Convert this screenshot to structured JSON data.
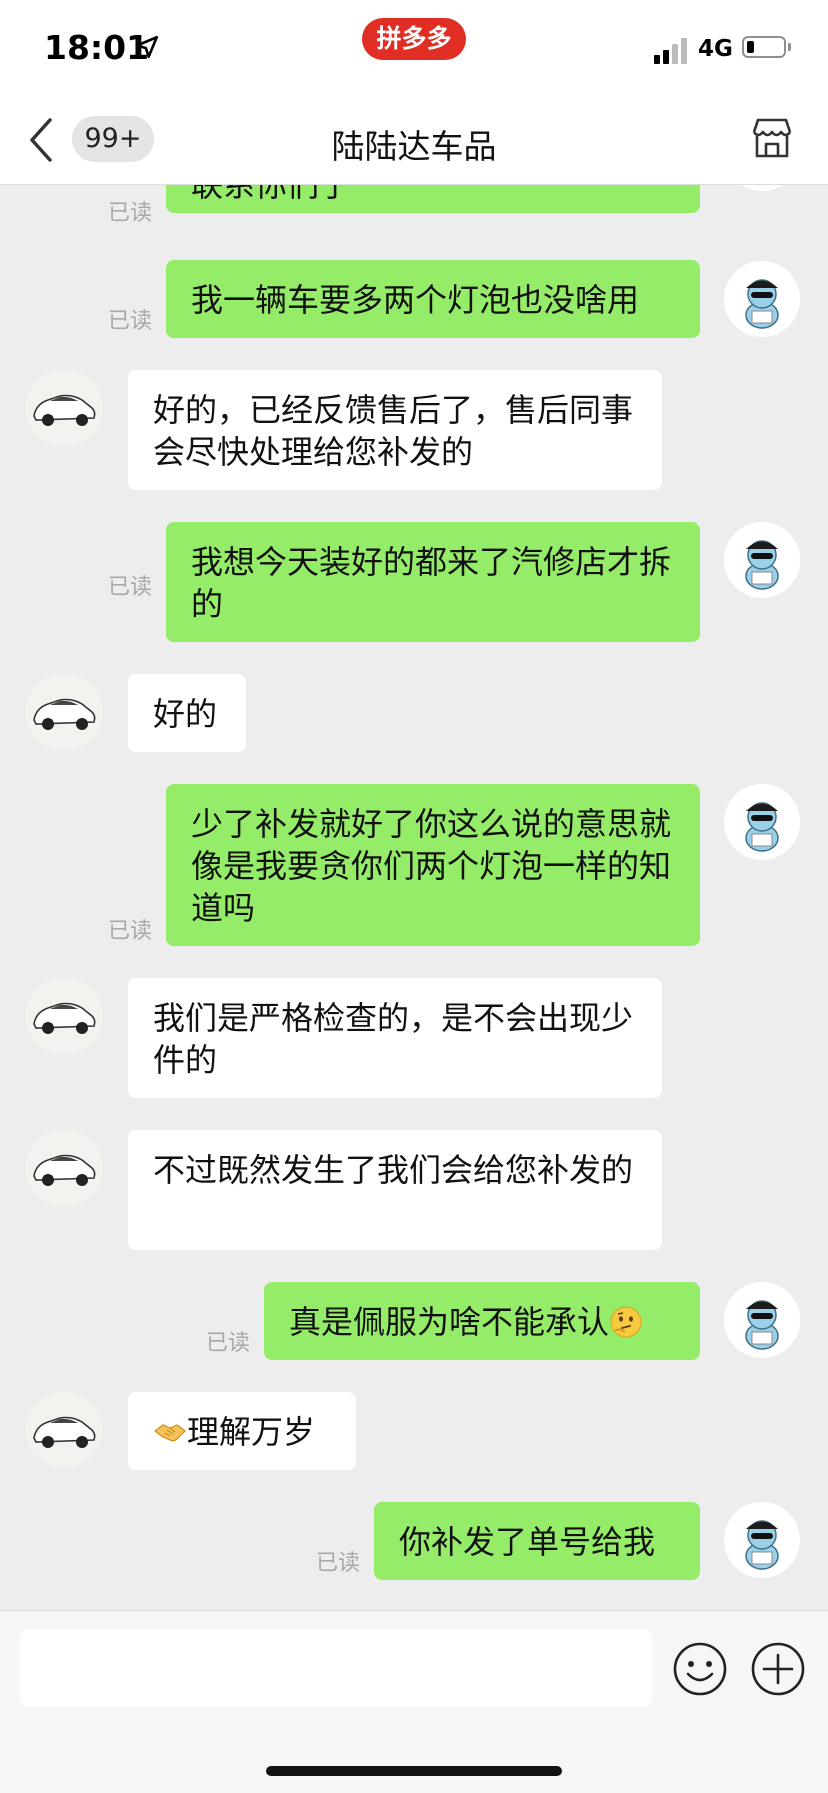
{
  "status_bar": {
    "time": "18:01",
    "network": "4G",
    "app_badge": "拼多多"
  },
  "nav": {
    "unread_count": "99+",
    "title": "陆陆达车品",
    "back_icon": "chevron-left-icon",
    "store_icon": "store-icon"
  },
  "read_label": "已读",
  "messages": [
    {
      "side": "out",
      "text": "联系你们了",
      "read": "已读"
    },
    {
      "side": "out",
      "text": "我一辆车要多两个灯泡也没啥用",
      "read": "已读"
    },
    {
      "side": "in",
      "text": "好的，已经反馈售后了，售后同事会尽快处理给您补发的"
    },
    {
      "side": "out",
      "text": "我想今天装好的都来了汽修店才拆的",
      "read": "已读"
    },
    {
      "side": "in",
      "text": "好的"
    },
    {
      "side": "out",
      "text": "少了补发就好了你这么说的意思就像是我要贪你们两个灯泡一样的知道吗",
      "read": "已读"
    },
    {
      "side": "in",
      "text": "我们是严格检查的，是不会出现少件的"
    },
    {
      "side": "in",
      "text": "不过既然发生了我们会给您补发的"
    },
    {
      "side": "out",
      "text": "真是佩服为啥不能承认",
      "emoji": "thinking-face-icon",
      "read": "已读"
    },
    {
      "side": "in",
      "text": "理解万岁",
      "emoji": "handshake-icon"
    },
    {
      "side": "out",
      "text": "你补发了单号给我",
      "read": "已读"
    }
  ],
  "input": {
    "placeholder": ""
  },
  "colors": {
    "outgoing_bubble": "#95ec69",
    "incoming_bubble": "#ffffff",
    "background": "#ededed",
    "brand": "#e02e24"
  }
}
